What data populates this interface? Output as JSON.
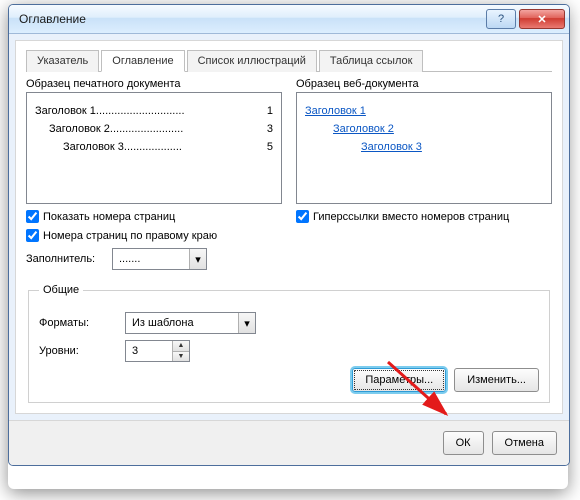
{
  "title": "Оглавление",
  "tabs": [
    "Указатель",
    "Оглавление",
    "Список иллюстраций",
    "Таблица ссылок"
  ],
  "activeTab": 1,
  "print": {
    "label": "Образец печатного документа",
    "rows": [
      {
        "head": "Заголовок 1",
        "page": "1",
        "indent": 0
      },
      {
        "head": "Заголовок 2",
        "page": "3",
        "indent": 1
      },
      {
        "head": "Заголовок 3",
        "page": "5",
        "indent": 2
      }
    ]
  },
  "web": {
    "label": "Образец веб-документа",
    "items": [
      "Заголовок 1",
      "Заголовок 2",
      "Заголовок 3"
    ]
  },
  "checks": {
    "showPages": "Показать номера страниц",
    "rightAlign": "Номера страниц по правому краю",
    "hyperlinks": "Гиперссылки вместо номеров страниц"
  },
  "fill": {
    "label": "Заполнитель:",
    "value": "......."
  },
  "group": {
    "legend": "Общие",
    "formats": {
      "label": "Форматы:",
      "value": "Из шаблона"
    },
    "levels": {
      "label": "Уровни:",
      "value": "3"
    },
    "params": "Параметры...",
    "modify": "Изменить..."
  },
  "buttons": {
    "ok": "ОК",
    "cancel": "Отмена"
  }
}
